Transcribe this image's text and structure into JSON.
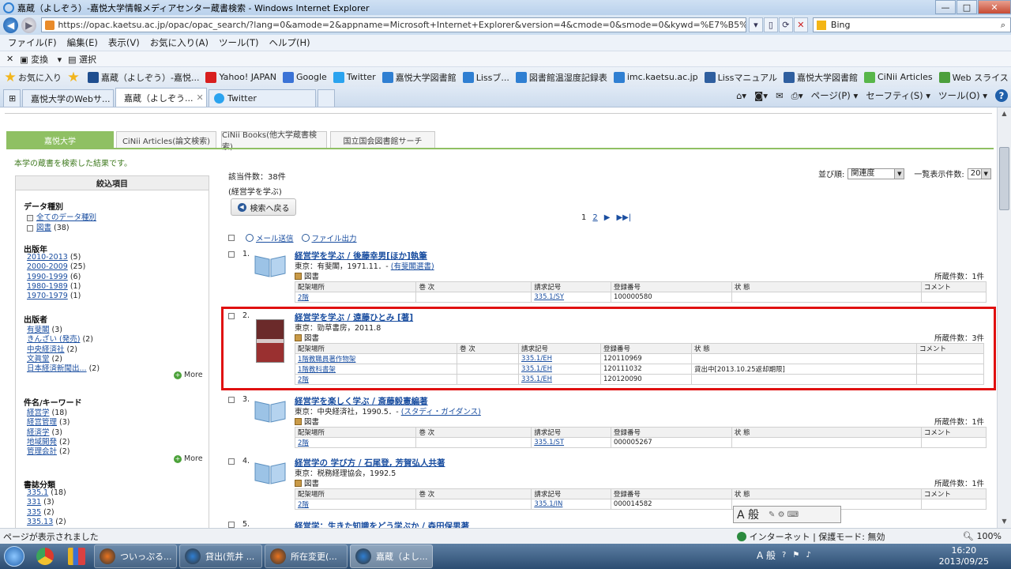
{
  "window": {
    "title": "嘉蔵（よしぞう）-嘉悦大学情報メディアセンター蔵書検索 - Windows Internet Explorer",
    "min": "—",
    "max": "□",
    "close": "✕"
  },
  "address": {
    "url": "https://opac.kaetsu.ac.jp/opac/opac_search/?lang=0&amode=2&appname=Microsoft+Internet+Explorer&version=4&cmode=0&smode=0&kywd=%E7%B5%8C%E5%96%B6%E5%",
    "search_engine": "Bing",
    "search_icon": "⌕"
  },
  "menu": [
    "ファイル(F)",
    "編集(E)",
    "表示(V)",
    "お気に入り(A)",
    "ツール(T)",
    "ヘルプ(H)"
  ],
  "command": {
    "close": "✕",
    "convert": "変換",
    "select": "選択"
  },
  "favorites": [
    {
      "label": "お気に入り",
      "color": "#f2b51c"
    },
    {
      "label": "",
      "color": "#f2b51c"
    },
    {
      "label": "嘉蔵（よしぞう）-嘉悦...",
      "color": "#1f4e8f"
    },
    {
      "label": "Yahoo! JAPAN",
      "color": "#d81e1e"
    },
    {
      "label": "Google",
      "color": "#3b73d6"
    },
    {
      "label": "Twitter",
      "color": "#2aa3ef"
    },
    {
      "label": "嘉悦大学図書館",
      "color": "#2f7fd2"
    },
    {
      "label": "Lissブ...",
      "color": "#2f7fd2"
    },
    {
      "label": "図書館温湿度記録表",
      "color": "#2f7fd2"
    },
    {
      "label": "imc.kaetsu.ac.jp",
      "color": "#2f7fd2"
    },
    {
      "label": "Lissマニュアル",
      "color": "#2f5f9f"
    },
    {
      "label": "嘉悦大学図書館",
      "color": "#2f5f9f"
    },
    {
      "label": "CiNii Articles",
      "color": "#58b64a"
    },
    {
      "label": "Web スライス ギャ...",
      "color": "#4c9f3c"
    }
  ],
  "browser_tabs": [
    {
      "label": "嘉悦大学のWebサ...",
      "color": "#2f7fd2"
    },
    {
      "label": "嘉蔵（よしぞう...",
      "color": "#1f4e8f"
    },
    {
      "label": "Twitter",
      "color": "#2aa3ef"
    }
  ],
  "toolbar": {
    "page": "ページ(P) ▾",
    "safety": "セーフティ(S) ▾",
    "tools": "ツール(O) ▾",
    "help": "?"
  },
  "site_tabs": [
    "嘉悦大学",
    "CiNii Articles(論文検索)",
    "CiNii Books(他大学蔵書検索)",
    "国立国会図書館サーチ"
  ],
  "note": "本学の蔵書を検索した結果です。",
  "facets": {
    "header": "絞込項目",
    "more": "More",
    "data_type": {
      "title": "データ種別",
      "items": [
        {
          "label": "全てのデータ種別",
          "count": ""
        },
        {
          "label": "図書",
          "count": "(38)"
        }
      ]
    },
    "year": {
      "title": "出版年",
      "items": [
        {
          "label": "2010-2013",
          "count": "(5)"
        },
        {
          "label": "2000-2009",
          "count": "(25)"
        },
        {
          "label": "1990-1999",
          "count": "(6)"
        },
        {
          "label": "1980-1989",
          "count": "(1)"
        },
        {
          "label": "1970-1979",
          "count": "(1)"
        }
      ]
    },
    "publisher": {
      "title": "出版者",
      "items": [
        {
          "label": "有斐閣",
          "count": "(3)"
        },
        {
          "label": "きんざい (発売)",
          "count": "(2)"
        },
        {
          "label": "中央経済社",
          "count": "(2)"
        },
        {
          "label": "文眞堂",
          "count": "(2)"
        },
        {
          "label": "日本経済新聞出...",
          "count": "(2)"
        }
      ]
    },
    "subject": {
      "title": "件名/キーワード",
      "items": [
        {
          "label": "経営学",
          "count": "(18)"
        },
        {
          "label": "経営管理",
          "count": "(3)"
        },
        {
          "label": "経済学",
          "count": "(3)"
        },
        {
          "label": "地域開発",
          "count": "(2)"
        },
        {
          "label": "管理会計",
          "count": "(2)"
        }
      ]
    },
    "classification": {
      "title": "書誌分類",
      "items": [
        {
          "label": "335.1",
          "count": "(18)"
        },
        {
          "label": "331",
          "count": "(3)"
        },
        {
          "label": "335",
          "count": "(2)"
        },
        {
          "label": "335.13",
          "count": "(2)"
        }
      ]
    }
  },
  "results": {
    "hits": "該当件数：38件",
    "query": "(経営学を学ぶ)",
    "back": "検索へ戻る",
    "sort_label": "並び順:",
    "sort_value": "関連度",
    "per_page_label": "一覧表示件数:",
    "per_page_value": "20",
    "pages": [
      "1",
      "2",
      "▶",
      "▶▶|"
    ],
    "mail": "メール送信",
    "file": "ファイル出力",
    "columns": [
      "配架場所",
      "巻 次",
      "請求記号",
      "登録番号",
      "状 態",
      "コメント"
    ],
    "records": [
      {
        "num": "1.",
        "title": "経営学を学ぶ / 後藤幸男[ほか]執筆",
        "pub": "東京：有斐閣，1971.11．-",
        "series": "(有斐閣選書)",
        "type": "図書",
        "count": "所蔵件数：1件",
        "holdings": [
          {
            "loc": "2階",
            "vol": "",
            "call": "335.1/SY",
            "reg": "100000580",
            "status": "",
            "comment": ""
          }
        ]
      },
      {
        "num": "2.",
        "title": "経営学を学ぶ / 遠藤ひとみ [著]",
        "pub": "東京：勁草書房，2011.8",
        "series": "",
        "type": "図書",
        "count": "所蔵件数：3件",
        "holdings": [
          {
            "loc": "1階教職員著作物架",
            "vol": "",
            "call": "335.1/EH",
            "reg": "120110969",
            "status": "",
            "comment": ""
          },
          {
            "loc": "1階教科書架",
            "vol": "",
            "call": "335.1/EH",
            "reg": "120111032",
            "status": "貸出中[2013.10.25返却期限]",
            "comment": ""
          },
          {
            "loc": "2階",
            "vol": "",
            "call": "335.1/EH",
            "reg": "120120090",
            "status": "",
            "comment": ""
          }
        ]
      },
      {
        "num": "3.",
        "title": "経営学を楽しく学ぶ / 斎藤毅憲編著",
        "pub": "東京：中央経済社，1990.5．-",
        "series": "(スタディ・ガイダンス)",
        "type": "図書",
        "count": "所蔵件数：1件",
        "holdings": [
          {
            "loc": "2階",
            "vol": "",
            "call": "335.1/ST",
            "reg": "000005267",
            "status": "",
            "comment": ""
          }
        ]
      },
      {
        "num": "4.",
        "title": "経営学の 学び方 / 石尾登, 芳賀弘人共著",
        "pub": "東京：税務経理協会，1992.5",
        "series": "",
        "type": "図書",
        "count": "所蔵件数：1件",
        "holdings": [
          {
            "loc": "2階",
            "vol": "",
            "call": "335.1/IN",
            "reg": "000014582",
            "status": "",
            "comment": ""
          }
        ]
      },
      {
        "num": "5.",
        "title": "経営学：生きた知識をどう学ぶか / 森田保男著",
        "pub": "",
        "series": "",
        "type": "",
        "count": "",
        "holdings": []
      }
    ]
  },
  "status": {
    "text": "ページが表示されました",
    "zone": "インターネット | 保護モード: 無効",
    "zoom": "100%"
  },
  "ime": {
    "label": "A 般"
  },
  "taskbar": {
    "apps": [
      {
        "label": "ついっぷる...",
        "color": "#e8731f"
      },
      {
        "label": "貸出(荒井 ...",
        "color": "#2f7fd2"
      },
      {
        "label": "所在変更(...",
        "color": "#e8731f"
      },
      {
        "label": "嘉蔵（よし...",
        "color": "#2f7fd2"
      }
    ],
    "time": "16:20",
    "date": "2013/09/25",
    "tray": "A 般"
  }
}
